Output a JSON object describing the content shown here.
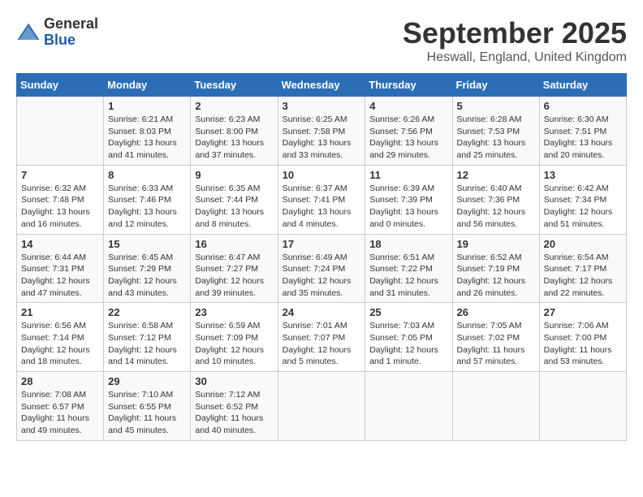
{
  "header": {
    "logo_line1": "General",
    "logo_line2": "Blue",
    "month_title": "September 2025",
    "location": "Heswall, England, United Kingdom"
  },
  "days_of_week": [
    "Sunday",
    "Monday",
    "Tuesday",
    "Wednesday",
    "Thursday",
    "Friday",
    "Saturday"
  ],
  "weeks": [
    [
      {
        "day": "",
        "info": ""
      },
      {
        "day": "1",
        "info": "Sunrise: 6:21 AM\nSunset: 8:03 PM\nDaylight: 13 hours\nand 41 minutes."
      },
      {
        "day": "2",
        "info": "Sunrise: 6:23 AM\nSunset: 8:00 PM\nDaylight: 13 hours\nand 37 minutes."
      },
      {
        "day": "3",
        "info": "Sunrise: 6:25 AM\nSunset: 7:58 PM\nDaylight: 13 hours\nand 33 minutes."
      },
      {
        "day": "4",
        "info": "Sunrise: 6:26 AM\nSunset: 7:56 PM\nDaylight: 13 hours\nand 29 minutes."
      },
      {
        "day": "5",
        "info": "Sunrise: 6:28 AM\nSunset: 7:53 PM\nDaylight: 13 hours\nand 25 minutes."
      },
      {
        "day": "6",
        "info": "Sunrise: 6:30 AM\nSunset: 7:51 PM\nDaylight: 13 hours\nand 20 minutes."
      }
    ],
    [
      {
        "day": "7",
        "info": "Sunrise: 6:32 AM\nSunset: 7:48 PM\nDaylight: 13 hours\nand 16 minutes."
      },
      {
        "day": "8",
        "info": "Sunrise: 6:33 AM\nSunset: 7:46 PM\nDaylight: 13 hours\nand 12 minutes."
      },
      {
        "day": "9",
        "info": "Sunrise: 6:35 AM\nSunset: 7:44 PM\nDaylight: 13 hours\nand 8 minutes."
      },
      {
        "day": "10",
        "info": "Sunrise: 6:37 AM\nSunset: 7:41 PM\nDaylight: 13 hours\nand 4 minutes."
      },
      {
        "day": "11",
        "info": "Sunrise: 6:39 AM\nSunset: 7:39 PM\nDaylight: 13 hours\nand 0 minutes."
      },
      {
        "day": "12",
        "info": "Sunrise: 6:40 AM\nSunset: 7:36 PM\nDaylight: 12 hours\nand 56 minutes."
      },
      {
        "day": "13",
        "info": "Sunrise: 6:42 AM\nSunset: 7:34 PM\nDaylight: 12 hours\nand 51 minutes."
      }
    ],
    [
      {
        "day": "14",
        "info": "Sunrise: 6:44 AM\nSunset: 7:31 PM\nDaylight: 12 hours\nand 47 minutes."
      },
      {
        "day": "15",
        "info": "Sunrise: 6:45 AM\nSunset: 7:29 PM\nDaylight: 12 hours\nand 43 minutes."
      },
      {
        "day": "16",
        "info": "Sunrise: 6:47 AM\nSunset: 7:27 PM\nDaylight: 12 hours\nand 39 minutes."
      },
      {
        "day": "17",
        "info": "Sunrise: 6:49 AM\nSunset: 7:24 PM\nDaylight: 12 hours\nand 35 minutes."
      },
      {
        "day": "18",
        "info": "Sunrise: 6:51 AM\nSunset: 7:22 PM\nDaylight: 12 hours\nand 31 minutes."
      },
      {
        "day": "19",
        "info": "Sunrise: 6:52 AM\nSunset: 7:19 PM\nDaylight: 12 hours\nand 26 minutes."
      },
      {
        "day": "20",
        "info": "Sunrise: 6:54 AM\nSunset: 7:17 PM\nDaylight: 12 hours\nand 22 minutes."
      }
    ],
    [
      {
        "day": "21",
        "info": "Sunrise: 6:56 AM\nSunset: 7:14 PM\nDaylight: 12 hours\nand 18 minutes."
      },
      {
        "day": "22",
        "info": "Sunrise: 6:58 AM\nSunset: 7:12 PM\nDaylight: 12 hours\nand 14 minutes."
      },
      {
        "day": "23",
        "info": "Sunrise: 6:59 AM\nSunset: 7:09 PM\nDaylight: 12 hours\nand 10 minutes."
      },
      {
        "day": "24",
        "info": "Sunrise: 7:01 AM\nSunset: 7:07 PM\nDaylight: 12 hours\nand 5 minutes."
      },
      {
        "day": "25",
        "info": "Sunrise: 7:03 AM\nSunset: 7:05 PM\nDaylight: 12 hours\nand 1 minute."
      },
      {
        "day": "26",
        "info": "Sunrise: 7:05 AM\nSunset: 7:02 PM\nDaylight: 11 hours\nand 57 minutes."
      },
      {
        "day": "27",
        "info": "Sunrise: 7:06 AM\nSunset: 7:00 PM\nDaylight: 11 hours\nand 53 minutes."
      }
    ],
    [
      {
        "day": "28",
        "info": "Sunrise: 7:08 AM\nSunset: 6:57 PM\nDaylight: 11 hours\nand 49 minutes."
      },
      {
        "day": "29",
        "info": "Sunrise: 7:10 AM\nSunset: 6:55 PM\nDaylight: 11 hours\nand 45 minutes."
      },
      {
        "day": "30",
        "info": "Sunrise: 7:12 AM\nSunset: 6:52 PM\nDaylight: 11 hours\nand 40 minutes."
      },
      {
        "day": "",
        "info": ""
      },
      {
        "day": "",
        "info": ""
      },
      {
        "day": "",
        "info": ""
      },
      {
        "day": "",
        "info": ""
      }
    ]
  ]
}
